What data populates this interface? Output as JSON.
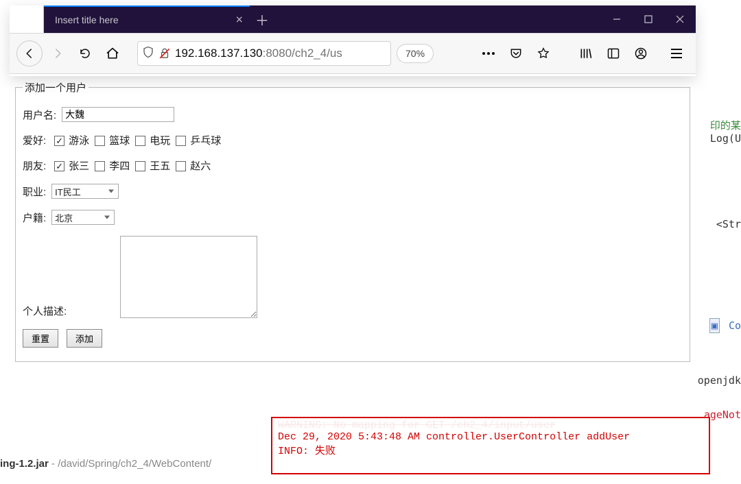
{
  "browser": {
    "tab_title": "Insert title here",
    "url_host": "192.168.137.130",
    "url_rest": ":8080/ch2_4/us",
    "zoom": "70%"
  },
  "form": {
    "legend": "添加一个用户",
    "username_label": "用户名:",
    "username_value": "大魏",
    "hobby_label": "爱好:",
    "hobby_opts": [
      "游泳",
      "篮球",
      "电玩",
      "乒乓球"
    ],
    "friends_label": "朋友:",
    "friends_opts": [
      "张三",
      "李四",
      "王五",
      "赵六"
    ],
    "job_label": "职业:",
    "job_value": "IT民工",
    "origin_label": "户籍:",
    "origin_value": "北京",
    "desc_label": "个人描述:",
    "reset_label": "重置",
    "submit_label": "添加"
  },
  "console": {
    "line0_faded": "WARNING: No mapping for GET /ch2_4/input/user",
    "line1": "Dec 29, 2020 5:43:48 AM controller.UserController addUser",
    "line2": "INFO: 失败"
  },
  "bg": {
    "jar_line_name": "ing-1.2.jar",
    "jar_line_path": " - /david/Spring/ch2_4/WebContent/",
    "right_top1": "印的某",
    "right_top2": "Log(U",
    "right_mid": "<Str",
    "right_lower_co": "Co",
    "right_openjdk": "openjdk",
    "right_ageNot": "ageNot"
  }
}
